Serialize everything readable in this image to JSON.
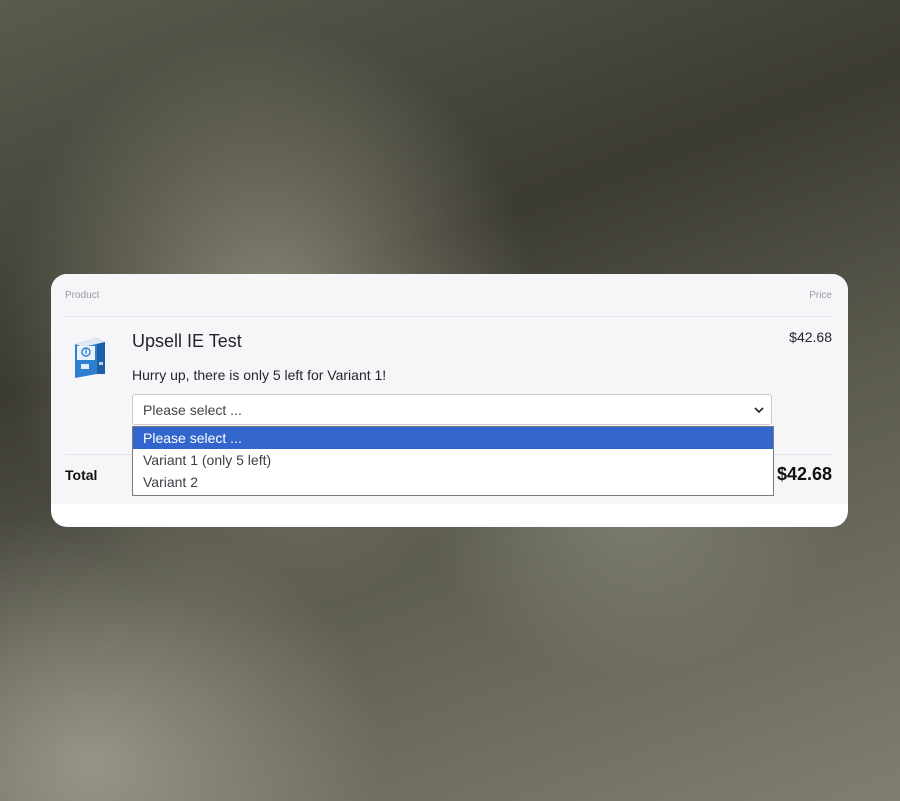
{
  "cart": {
    "header": {
      "product_label": "Product",
      "price_label": "Price"
    },
    "item": {
      "title": "Upsell IE Test",
      "price": "$42.68",
      "image_icon": "software-box-icon",
      "stock_notice": "Hurry up, there is only 5 left for Variant 1!"
    },
    "variant_select": {
      "selected_value": "Please select ...",
      "options": [
        {
          "label": "Please select ...",
          "highlighted": true
        },
        {
          "label": "Variant 1 (only 5 left)",
          "highlighted": false
        },
        {
          "label": "Variant 2",
          "highlighted": false
        }
      ]
    },
    "total": {
      "label": "Total",
      "value": "$42.68"
    }
  },
  "colors": {
    "highlight": "#3366cc",
    "card_background": "#f6f6f9"
  }
}
